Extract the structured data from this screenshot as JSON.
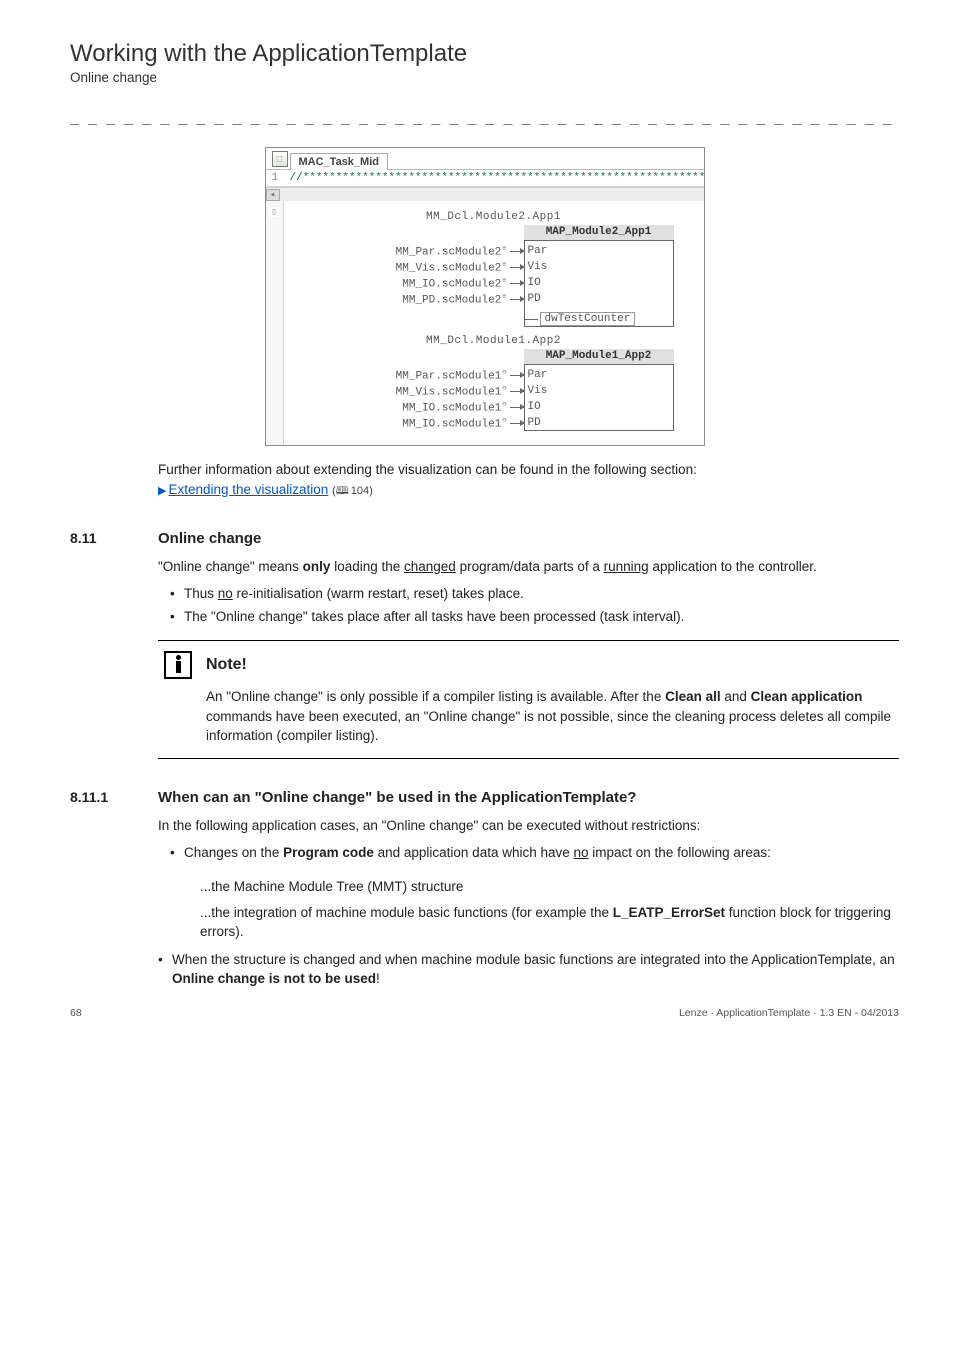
{
  "header": {
    "title": "Working with the ApplicationTemplate",
    "subtitle": "Online change"
  },
  "dashline": "_ _ _ _ _ _ _ _ _ _ _ _ _ _ _ _ _ _ _ _ _ _ _ _ _ _ _ _ _ _ _ _ _ _ _ _ _ _ _ _ _ _ _ _ _ _ _ _ _ _ _ _ _ _ _ _ _ _ _ _ _ _ _ _",
  "diagram": {
    "tab_label": "MAC_Task_Mid",
    "comment_num": "1",
    "comment": "//****************************************************************",
    "block1": {
      "title": "MM_Dcl.Module2.App1",
      "head": "MAP_Module2_App1",
      "rows": [
        {
          "sig": "MM_Par.scModule2",
          "port": "Par"
        },
        {
          "sig": "MM_Vis.scModule2",
          "port": "Vis"
        },
        {
          "sig": "MM_IO.scModule2",
          "port": "IO"
        },
        {
          "sig": "MM_PD.scModule2",
          "port": "PD"
        }
      ],
      "output": "dwTestCounter"
    },
    "block2": {
      "title": "MM_Dcl.Module1.App2",
      "head": "MAP_Module1_App2",
      "rows": [
        {
          "sig": "MM_Par.scModule1",
          "port": "Par"
        },
        {
          "sig": "MM_Vis.scModule1",
          "port": "Vis"
        },
        {
          "sig": "MM_IO.scModule1",
          "port": "IO"
        },
        {
          "sig": "MM_IO.scModule1",
          "port": "PD"
        }
      ]
    }
  },
  "after_diagram": {
    "text": "Further information about extending the visualization can be found in the following section:",
    "link": "Extending the visualization",
    "ref": "104"
  },
  "sec811": {
    "num": "8.11",
    "title": "Online change",
    "intro_a": "\"Online change\" means ",
    "intro_only": "only",
    "intro_b": " loading the ",
    "intro_changed": "changed",
    "intro_c": " program/data parts of a ",
    "intro_running": "running",
    "intro_d": " application to the controller.",
    "bullets": [
      {
        "pre": "Thus ",
        "u": "no",
        "post": " re-initialisation (warm restart, reset) takes place."
      },
      {
        "pre": "The \"Online change\" takes place after all tasks have been processed (task interval).",
        "u": "",
        "post": ""
      }
    ]
  },
  "note": {
    "title": "Note!",
    "line1a": "An \"Online change\" is only possible if a compiler listing is available. After the ",
    "line1b": "Clean all",
    "line2a": "and ",
    "line2b": "Clean application",
    "line2c": " commands have been executed, an \"Online change\" is not possible, since the cleaning process deletes all compile information (compiler listing)."
  },
  "sec8111": {
    "num": "8.11.1",
    "title": "When can an \"Online change\" be used in the ApplicationTemplate?",
    "intro": "In the following application cases, an \"Online change\" can be executed without restrictions:",
    "b1_a": "Changes on the ",
    "b1_b": "Program code",
    "b1_c": " and application data which have ",
    "b1_no": "no",
    "b1_d": " impact on the following areas:",
    "sub1": "...the Machine Module Tree (MMT) structure",
    "sub2a": "...the integration of machine module basic functions (for example the ",
    "sub2b": "L_EATP_ErrorSet",
    "sub2c": " function block for triggering errors).",
    "b2_a": "When the structure is changed and when machine module basic functions are integrated into the ApplicationTemplate, an ",
    "b2_b": "Online change is not to be used",
    "b2_c": "!"
  },
  "footer": {
    "page": "68",
    "doc": "Lenze · ApplicationTemplate · 1.3 EN - 04/2013"
  }
}
